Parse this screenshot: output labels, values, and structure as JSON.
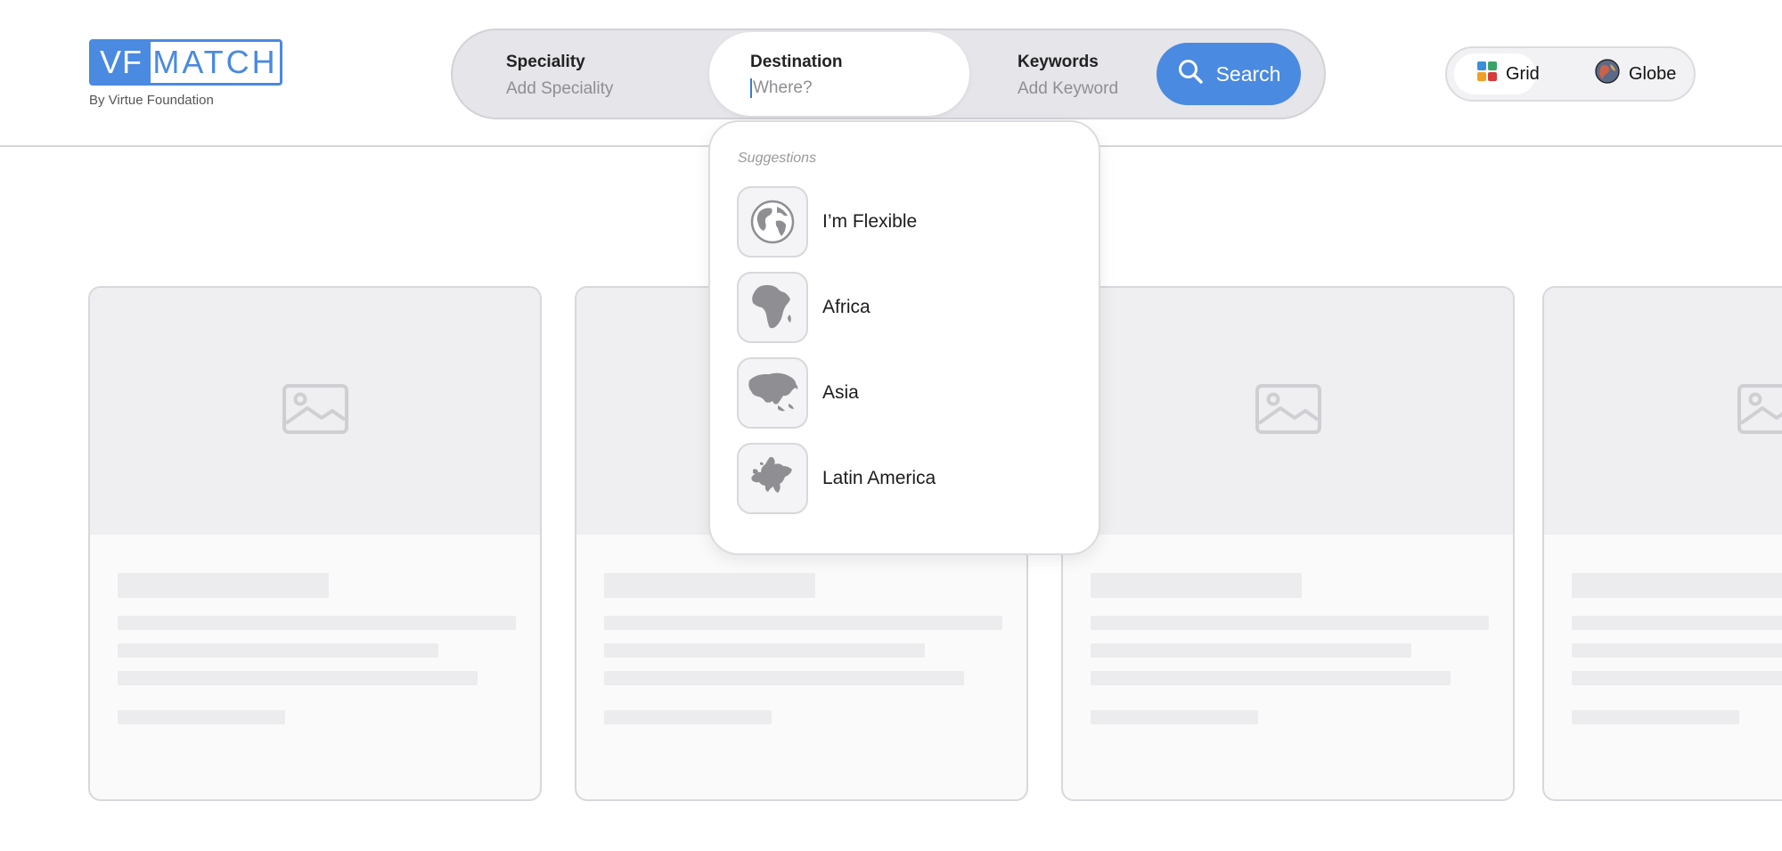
{
  "brand": {
    "logo_left": "VF",
    "logo_right": "MATCH",
    "tagline": "By Virtue Foundation",
    "accent_color": "#4a8ae0"
  },
  "search": {
    "speciality": {
      "label": "Speciality",
      "placeholder": "Add Speciality"
    },
    "destination": {
      "label": "Destination",
      "placeholder": "Where?",
      "value": ""
    },
    "keywords": {
      "label": "Keywords",
      "placeholder": "Add Keyword"
    },
    "button_label": "Search",
    "button_icon": "search-icon"
  },
  "view_toggle": {
    "grid_label": "Grid",
    "globe_label": "Globe",
    "selected": "Grid"
  },
  "dropdown": {
    "title": "Suggestions",
    "items": [
      {
        "label": "I’m Flexible",
        "icon": "globe-icon"
      },
      {
        "label": "Africa",
        "icon": "africa-map-icon"
      },
      {
        "label": "Asia",
        "icon": "asia-map-icon"
      },
      {
        "label": "Latin America",
        "icon": "europe-map-icon"
      }
    ]
  },
  "cards": {
    "state": "loading",
    "placeholder_icon": "image-placeholder-icon"
  }
}
